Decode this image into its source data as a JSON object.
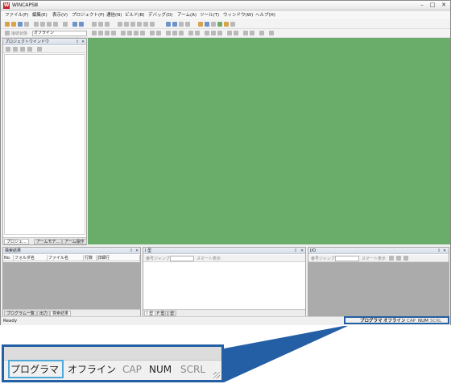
{
  "window": {
    "title": "WINCAPSⅢ",
    "app_icon": "W",
    "min": "–",
    "max": "□",
    "close": "✕"
  },
  "menu": [
    "ファイル(F)",
    "編集(E)",
    "表示(V)",
    "プロジェクト(P)",
    "通信(N)",
    "ビルド(B)",
    "デバッグ(D)",
    "アーム(A)",
    "ツール(T)",
    "ウィンドウ(W)",
    "ヘルプ(H)"
  ],
  "toolbar": {
    "connection_label": "接続状態",
    "connection_value": "オフライン"
  },
  "project_panel": {
    "title": "プロジェクトウインドウ",
    "pin": "⇧",
    "close": "✕",
    "tabs": [
      "プロジェ...",
      "アームモデ...",
      "アーム操作"
    ]
  },
  "search_panel": {
    "title": "検索結果",
    "columns": [
      "No.",
      "フォルダ名",
      "ファイル名",
      "行数",
      "詳細行"
    ],
    "tabs": [
      "プログラム一覧",
      "出力",
      "検索結果"
    ]
  },
  "i_panel": {
    "title": "I 型",
    "jump_label": "番号ジャンプ",
    "smart_label": "スマート表示",
    "tabs": [
      "I 型",
      "F 型",
      "J 型"
    ]
  },
  "io_panel": {
    "title": "I/O",
    "jump_label": "番号ジャンプ",
    "smart_label": "スマート表示"
  },
  "status": {
    "ready": "Ready",
    "program": "プログラマ",
    "offline": "オフライン",
    "cap": "CAP",
    "num": "NUM",
    "scrl": "SCRL"
  },
  "colors": {
    "workspace": "#6aad6b",
    "callout": "#245fa6",
    "highlight": "#4ea8d8"
  }
}
